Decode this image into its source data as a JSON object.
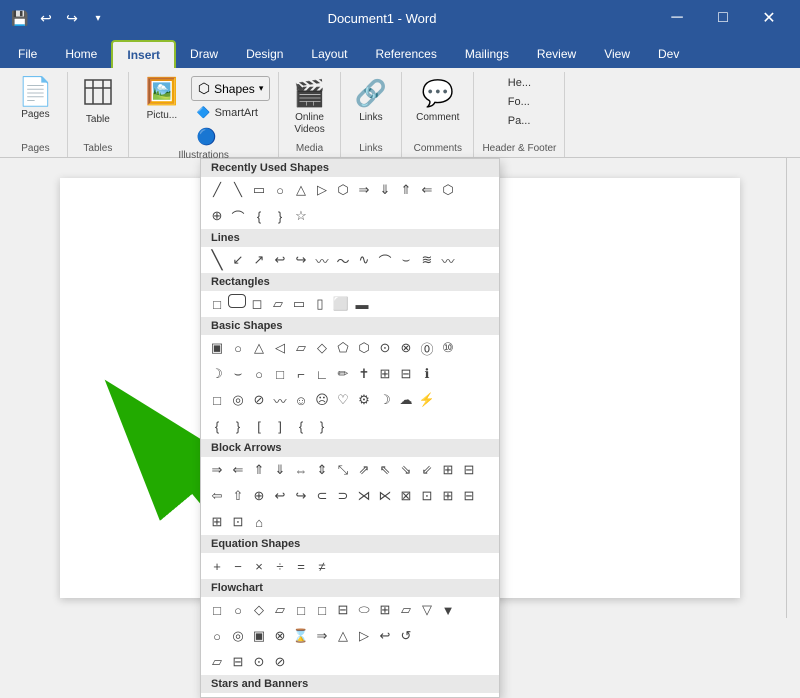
{
  "titleBar": {
    "title": "Document1 - Word",
    "saveIcon": "💾",
    "undoIcon": "↩",
    "redoIcon": "↪",
    "customizeIcon": "▾"
  },
  "ribbonTabs": [
    "File",
    "Home",
    "Insert",
    "Draw",
    "Design",
    "Layout",
    "References",
    "Mailings",
    "Review",
    "View",
    "Dev"
  ],
  "activeTab": "Insert",
  "groups": {
    "pages": {
      "label": "Pages",
      "buttons": [
        {
          "icon": "📄",
          "label": "Pages"
        }
      ]
    },
    "tables": {
      "label": "Tables",
      "buttons": [
        {
          "icon": "⊞",
          "label": "Table"
        }
      ]
    },
    "illustrations": {
      "label": "Illustrations",
      "shapesLabel": "Shapes",
      "smartArtLabel": "SmartArt",
      "picturesLabel": "Pictu..."
    },
    "media": {
      "label": "Media",
      "buttons": [
        {
          "icon": "🎬",
          "label": "Online\nVideos"
        }
      ]
    },
    "links": {
      "label": "Links",
      "buttons": [
        {
          "icon": "🔗",
          "label": "Links"
        }
      ]
    },
    "comments": {
      "label": "Comments",
      "buttons": [
        {
          "icon": "💬",
          "label": "Comment"
        }
      ]
    },
    "header": {
      "label": "Header & Footer",
      "items": [
        "He...",
        "Fo...",
        "Pa..."
      ]
    }
  },
  "shapesDropdown": {
    "sections": [
      {
        "title": "Recently Used Shapes",
        "rows": [
          [
            "▭",
            "╲",
            "╱",
            "□",
            "○",
            "△",
            "⬡",
            "⇒",
            "↪",
            "↩",
            "⇐",
            "⬡"
          ],
          [
            "⊕",
            "⌒",
            "⌣",
            "❴",
            "❵",
            "☆"
          ]
        ]
      },
      {
        "title": "Lines",
        "rows": [
          [
            "╲",
            "〜",
            "↙",
            "↗",
            "↩",
            "↪",
            "〰",
            "〜",
            "∿",
            "⌒",
            "⌣",
            "≋",
            "〰"
          ]
        ]
      },
      {
        "title": "Rectangles",
        "rows": [
          [
            "□",
            "□",
            "○",
            "⬭",
            "▱",
            "▭",
            "⬜",
            "▭"
          ]
        ]
      },
      {
        "title": "Basic Shapes",
        "rows": [
          [
            "▣",
            "○",
            "△",
            "▷",
            "⬡",
            "◇",
            "⬡",
            "⬡",
            "⊙",
            "⊗",
            "⓪"
          ],
          [
            "⑩",
            "☽",
            "⌣",
            "○",
            "□",
            "⊏",
            "∟",
            "✏",
            "✝",
            "⊞",
            "⊟",
            "⊞",
            "ℹ"
          ],
          [
            "□",
            "◎",
            "⊘",
            "〰",
            "☺",
            "☹",
            "♡",
            "⚙",
            "☽",
            "☁",
            "⌒"
          ],
          [
            "❴",
            "❵",
            "❴",
            "❵",
            "❴",
            "❵",
            "❴",
            "❵"
          ]
        ]
      },
      {
        "title": "Block Arrows",
        "rows": [
          [
            "⇒",
            "⇐",
            "⇑",
            "⇓",
            "⇔",
            "⇕",
            "⤡",
            "⇗",
            "⇖",
            "⇘",
            "⇙",
            "⊞",
            "⊟"
          ],
          [
            "⇦",
            "⇧",
            "⊕",
            "↩",
            "↪",
            "⊂",
            "⊃",
            "⋊",
            "⋉",
            "⊠",
            "⊡",
            "⊞",
            "⊟"
          ],
          [
            "⊞",
            "⊡",
            "⌂"
          ]
        ]
      },
      {
        "title": "Equation Shapes",
        "rows": [
          [
            "+",
            "−",
            "×",
            "÷",
            "=",
            "≠"
          ]
        ]
      },
      {
        "title": "Flowchart",
        "rows": [
          [
            "□",
            "○",
            "◇",
            "▱",
            "□",
            "□",
            "⊟",
            "⬭",
            "⊞",
            "▱",
            "▽",
            "▼"
          ],
          [
            "○",
            "◎",
            "▣",
            "⊗",
            "⌛",
            "⇒",
            "△",
            "▷",
            "↩",
            "↺"
          ],
          [
            "▱",
            "⊟",
            "⊙",
            "⊘"
          ]
        ]
      },
      {
        "title": "Stars and Banners",
        "rows": []
      }
    ]
  }
}
